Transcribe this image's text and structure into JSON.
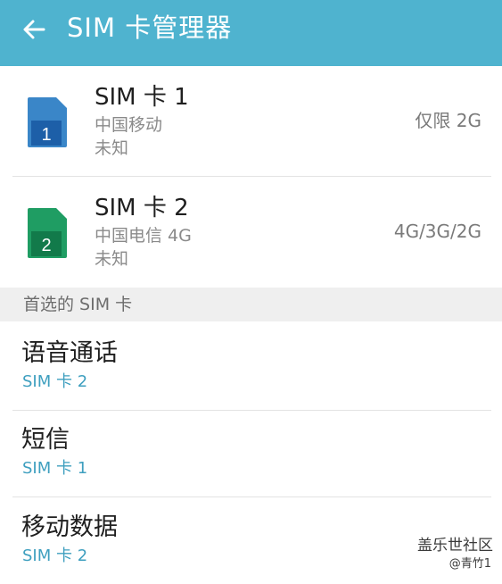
{
  "header": {
    "title": "SIM 卡管理器",
    "back_icon": "arrow-left-icon",
    "bg_color": "#4fb3cf"
  },
  "sim_cards": [
    {
      "name": "SIM 卡 1",
      "carrier": "中国移动",
      "status": "未知",
      "network": "仅限 2G",
      "slot_number": "1",
      "icon": "sim-card-icon",
      "color": "#3a86c8"
    },
    {
      "name": "SIM 卡 2",
      "carrier": "中国电信 4G",
      "status": "未知",
      "network": "4G/3G/2G",
      "slot_number": "2",
      "icon": "sim-card-icon",
      "color": "#1f9d63"
    }
  ],
  "preferred_section": {
    "header": "首选的 SIM 卡",
    "items": [
      {
        "title": "语音通话",
        "value": "SIM 卡 2"
      },
      {
        "title": "短信",
        "value": "SIM 卡 1"
      },
      {
        "title": "移动数据",
        "value": "SIM 卡 2"
      }
    ],
    "value_color": "#3e9fbf"
  },
  "watermark": {
    "line1": "盖乐世社区",
    "line2": "@青竹1"
  }
}
